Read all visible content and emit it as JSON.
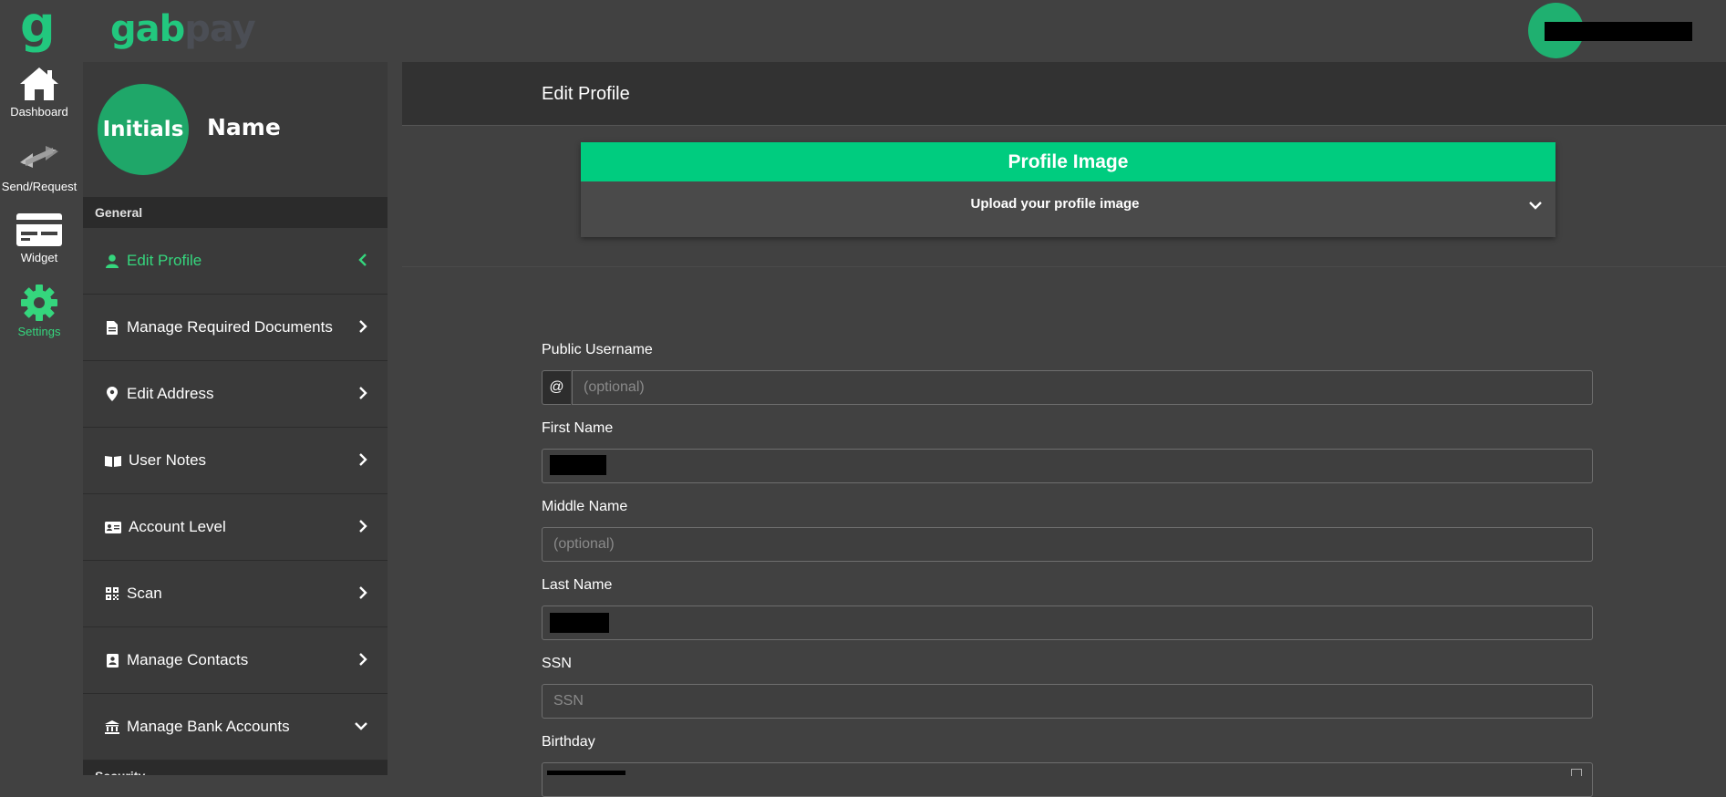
{
  "brand": {
    "short": "g",
    "logo_part1": "gab",
    "logo_part2": "pay",
    "accent_color": "#22c77e"
  },
  "rail": {
    "items": [
      {
        "label": "Dashboard",
        "icon": "home-icon"
      },
      {
        "label": "Send/Request",
        "icon": "transfer-icon"
      },
      {
        "label": "Widget",
        "icon": "card-icon"
      },
      {
        "label": "Settings",
        "icon": "gear-icon",
        "active": true
      }
    ]
  },
  "profile": {
    "initials": "Initials",
    "name": "Name"
  },
  "sidebar": {
    "section_general": "General",
    "section_security": "Security",
    "items": [
      {
        "label": "Edit Profile",
        "icon": "user-icon",
        "active": true,
        "chevron": "left"
      },
      {
        "label": "Manage Required Documents",
        "icon": "document-icon",
        "chevron": "right"
      },
      {
        "label": "Edit Address",
        "icon": "map-pin-icon",
        "chevron": "right"
      },
      {
        "label": "User Notes",
        "icon": "book-icon",
        "chevron": "right"
      },
      {
        "label": "Account Level",
        "icon": "id-card-icon",
        "chevron": "right"
      },
      {
        "label": "Scan",
        "icon": "qr-code-icon",
        "chevron": "right"
      },
      {
        "label": "Manage Contacts",
        "icon": "contact-book-icon",
        "chevron": "right"
      },
      {
        "label": "Manage Bank Accounts",
        "icon": "bank-icon",
        "chevron": "down"
      }
    ]
  },
  "main": {
    "title": "Edit Profile",
    "profile_image": {
      "title": "Profile Image",
      "subtitle": "Upload your profile image"
    },
    "form": {
      "public_username": {
        "label": "Public Username",
        "prefix": "@",
        "placeholder": "(optional)",
        "value": ""
      },
      "first_name": {
        "label": "First Name",
        "value": ""
      },
      "middle_name": {
        "label": "Middle Name",
        "placeholder": "(optional)",
        "value": ""
      },
      "last_name": {
        "label": "Last Name",
        "value": ""
      },
      "ssn": {
        "label": "SSN",
        "placeholder": "SSN",
        "value": ""
      },
      "birthday": {
        "label": "Birthday",
        "value": ""
      }
    }
  }
}
